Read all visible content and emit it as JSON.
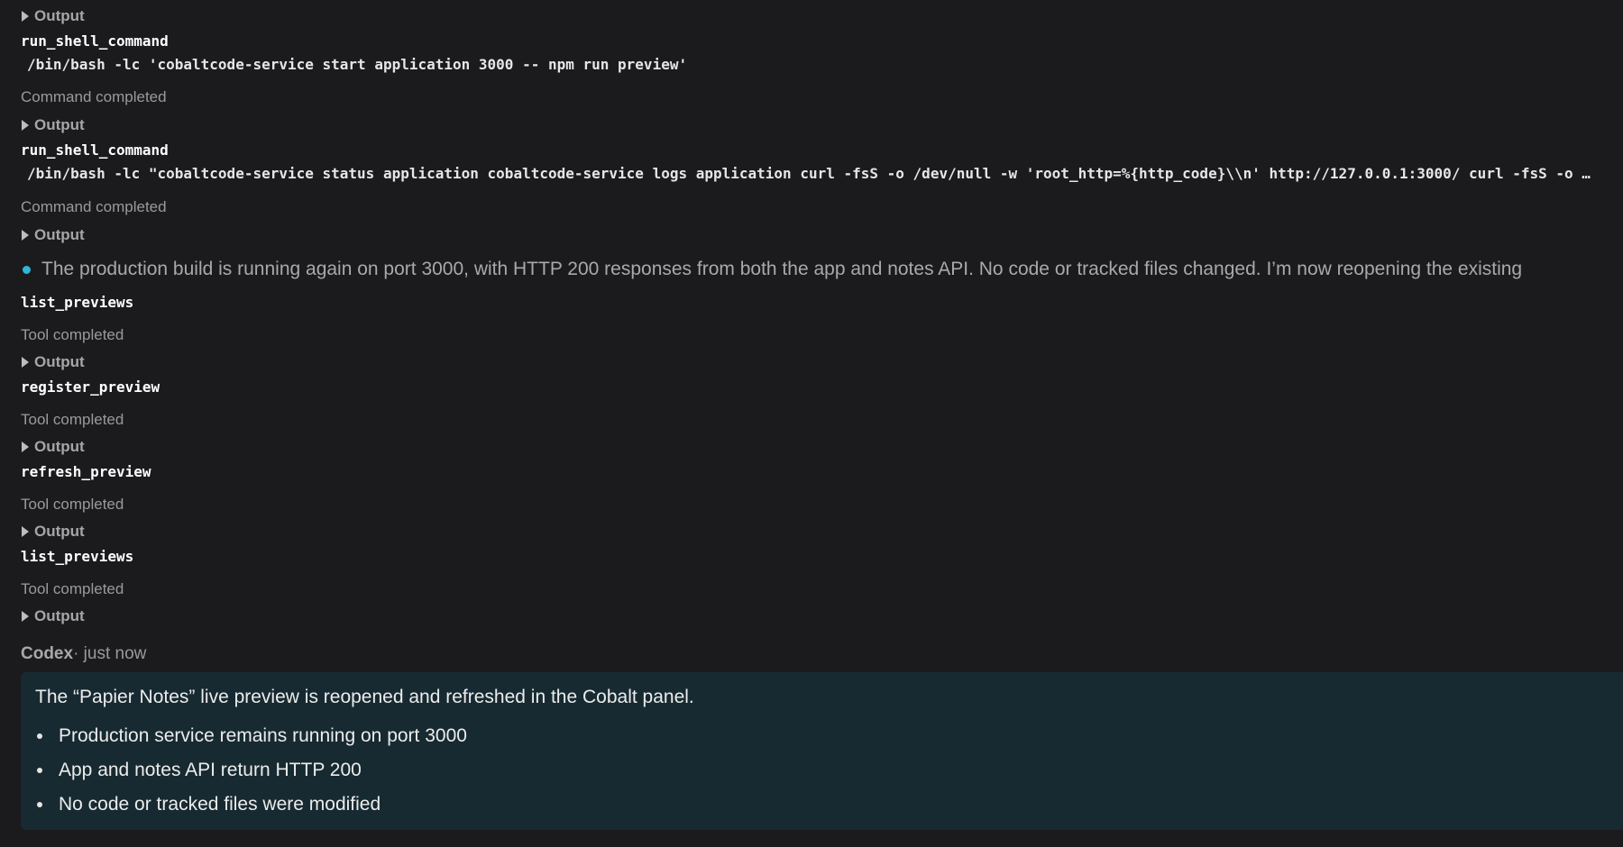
{
  "output_label": "Output",
  "entries": {
    "cmd1": {
      "tool": "run_shell_command",
      "command": "/bin/bash -lc 'cobaltcode-service start application 3000 -- npm run preview'",
      "status": "Command completed"
    },
    "cmd2": {
      "tool": "run_shell_command",
      "command": "/bin/bash -lc \"cobaltcode-service status application cobaltcode-service logs application curl -fsS -o /dev/null -w 'root_http=%{http_code}\\\\n' http://127.0.0.1:3000/ curl -fsS -o …",
      "status": "Command completed"
    },
    "message": "The production build is running again on port 3000, with HTTP 200 responses from both the app and notes API. No code or tracked files changed. I’m now reopening the existing",
    "tool1": {
      "tool": "list_previews",
      "status": "Tool completed"
    },
    "tool2": {
      "tool": "register_preview",
      "status": "Tool completed"
    },
    "tool3": {
      "tool": "refresh_preview",
      "status": "Tool completed"
    },
    "tool4": {
      "tool": "list_previews",
      "status": "Tool completed"
    }
  },
  "codex": {
    "author": "Codex",
    "time": "· just now",
    "headline": "The “Papier Notes” live preview is reopened and refreshed in the Cobalt panel.",
    "bullets": [
      "Production service remains running on port 3000",
      "App and notes API return HTTP 200",
      "No code or tracked files were modified"
    ]
  },
  "colors": {
    "background": "#1b1b1d",
    "summary_background": "#172a31",
    "accent_dot": "#2fb6d8"
  }
}
